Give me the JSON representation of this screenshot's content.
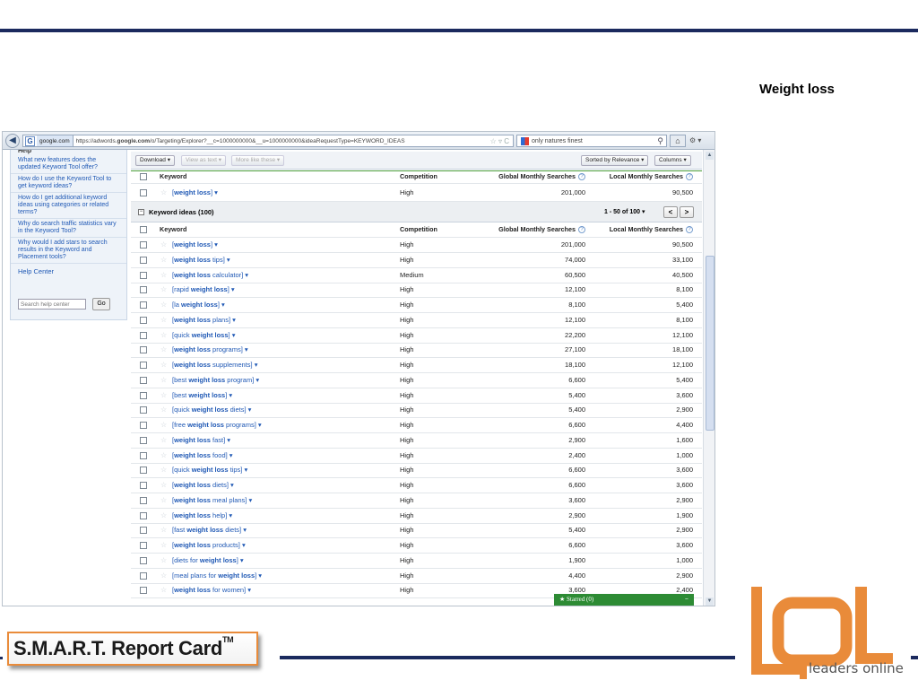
{
  "slide": {
    "title": "Weight loss",
    "report_card": "S.M.A.R.T. Report Card",
    "report_card_tm": "TM",
    "logo_text": "leaders online"
  },
  "browser": {
    "url_domain": "google.com",
    "url_prefix": "https://adwords.",
    "url_host": "google.com",
    "url_path": "/o/Targeting/Explorer?__c=1000000000&__u=1000000000&ideaRequestType=KEYWORD_IDEAS",
    "search_text": "only natures finest",
    "back_icon": "back-arrow-icon",
    "home_icon": "home-icon"
  },
  "sidebar": {
    "header": "Help",
    "links": [
      "What new features does the updated Keyword Tool offer?",
      "How do I use the Keyword Tool to get keyword ideas?",
      "How do I get additional keyword ideas using categories or related terms?",
      "Why do search traffic statistics vary in the Keyword Tool?",
      "Why would I add stars to search results in the Keyword and Placement tools?"
    ],
    "help_center": "Help Center",
    "search_placeholder": "Search help center",
    "go": "Go"
  },
  "toolbar": {
    "download": "Download ▾",
    "view_as_text": "View as text ▾",
    "more_like_these": "More like these ▾",
    "sorted": "Sorted by Relevance ▾",
    "columns": "Columns ▾"
  },
  "columns": {
    "keyword": "Keyword",
    "competition": "Competition",
    "global": "Global Monthly Searches",
    "local": "Local Monthly Searches"
  },
  "search_term_row": {
    "pre": "[",
    "bold": "weight loss",
    "post": "] ▾",
    "competition": "High",
    "global": "201,000",
    "local": "90,500"
  },
  "ideas": {
    "title": "Keyword ideas (100)",
    "pagination": "1 - 50 of 100",
    "prev": "<",
    "next": ">"
  },
  "rows": [
    {
      "pre": "[",
      "bold": "weight loss",
      "post": "] ▾",
      "competition": "High",
      "global": "201,000",
      "local": "90,500"
    },
    {
      "pre": "[",
      "bold": "weight loss",
      "post": " tips] ▾",
      "competition": "High",
      "global": "74,000",
      "local": "33,100"
    },
    {
      "pre": "[",
      "bold": "weight loss",
      "post": " calculator] ▾",
      "competition": "Medium",
      "global": "60,500",
      "local": "40,500"
    },
    {
      "pre": "[rapid ",
      "bold": "weight loss",
      "post": "] ▾",
      "competition": "High",
      "global": "12,100",
      "local": "8,100"
    },
    {
      "pre": "[la ",
      "bold": "weight loss",
      "post": "] ▾",
      "competition": "High",
      "global": "8,100",
      "local": "5,400"
    },
    {
      "pre": "[",
      "bold": "weight loss",
      "post": " plans] ▾",
      "competition": "High",
      "global": "12,100",
      "local": "8,100"
    },
    {
      "pre": "[quick ",
      "bold": "weight loss",
      "post": "] ▾",
      "competition": "High",
      "global": "22,200",
      "local": "12,100"
    },
    {
      "pre": "[",
      "bold": "weight loss",
      "post": " programs] ▾",
      "competition": "High",
      "global": "27,100",
      "local": "18,100"
    },
    {
      "pre": "[",
      "bold": "weight loss",
      "post": " supplements] ▾",
      "competition": "High",
      "global": "18,100",
      "local": "12,100"
    },
    {
      "pre": "[best ",
      "bold": "weight loss",
      "post": " program] ▾",
      "competition": "High",
      "global": "6,600",
      "local": "5,400"
    },
    {
      "pre": "[best ",
      "bold": "weight loss",
      "post": "] ▾",
      "competition": "High",
      "global": "5,400",
      "local": "3,600"
    },
    {
      "pre": "[quick ",
      "bold": "weight loss",
      "post": " diets] ▾",
      "competition": "High",
      "global": "5,400",
      "local": "2,900"
    },
    {
      "pre": "[free ",
      "bold": "weight loss",
      "post": " programs] ▾",
      "competition": "High",
      "global": "6,600",
      "local": "4,400"
    },
    {
      "pre": "[",
      "bold": "weight loss",
      "post": " fast] ▾",
      "competition": "High",
      "global": "2,900",
      "local": "1,600"
    },
    {
      "pre": "[",
      "bold": "weight loss",
      "post": " food] ▾",
      "competition": "High",
      "global": "2,400",
      "local": "1,000"
    },
    {
      "pre": "[quick ",
      "bold": "weight loss",
      "post": " tips] ▾",
      "competition": "High",
      "global": "6,600",
      "local": "3,600"
    },
    {
      "pre": "[",
      "bold": "weight loss",
      "post": " diets] ▾",
      "competition": "High",
      "global": "6,600",
      "local": "3,600"
    },
    {
      "pre": "[",
      "bold": "weight loss",
      "post": " meal plans] ▾",
      "competition": "High",
      "global": "3,600",
      "local": "2,900"
    },
    {
      "pre": "[",
      "bold": "weight loss",
      "post": " help] ▾",
      "competition": "High",
      "global": "2,900",
      "local": "1,900"
    },
    {
      "pre": "[fast ",
      "bold": "weight loss",
      "post": " diets] ▾",
      "competition": "High",
      "global": "5,400",
      "local": "2,900"
    },
    {
      "pre": "[",
      "bold": "weight loss",
      "post": " products] ▾",
      "competition": "High",
      "global": "6,600",
      "local": "3,600"
    },
    {
      "pre": "[diets for ",
      "bold": "weight loss",
      "post": "] ▾",
      "competition": "High",
      "global": "1,900",
      "local": "1,000"
    },
    {
      "pre": "[meal plans for ",
      "bold": "weight loss",
      "post": "] ▾",
      "competition": "High",
      "global": "4,400",
      "local": "2,900"
    },
    {
      "pre": "[",
      "bold": "weight loss",
      "post": " for women] ▾",
      "competition": "High",
      "global": "3,600",
      "local": "2,400"
    }
  ],
  "starred": {
    "label": "★ Starred (0)",
    "collapse": "−"
  }
}
